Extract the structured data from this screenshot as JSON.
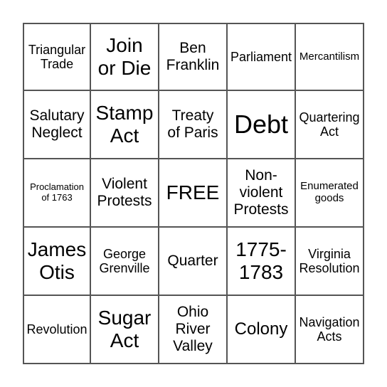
{
  "board": {
    "cells": [
      {
        "text": "Triangular\nTrade",
        "size": "s-md"
      },
      {
        "text": "Join\nor Die",
        "size": "s-xl"
      },
      {
        "text": "Ben\nFranklin",
        "size": "s-ml"
      },
      {
        "text": "Parliament",
        "size": "s-md"
      },
      {
        "text": "Mercantilism",
        "size": "s-sm"
      },
      {
        "text": "Salutary\nNeglect",
        "size": "s-ml"
      },
      {
        "text": "Stamp\nAct",
        "size": "s-xl"
      },
      {
        "text": "Treaty\nof Paris",
        "size": "s-ml"
      },
      {
        "text": "Debt",
        "size": "s-xxl"
      },
      {
        "text": "Quartering\nAct",
        "size": "s-md"
      },
      {
        "text": "Proclamation\nof 1763",
        "size": "s-xs"
      },
      {
        "text": "Violent\nProtests",
        "size": "s-ml"
      },
      {
        "text": "FREE",
        "size": "s-xl"
      },
      {
        "text": "Non-\nviolent\nProtests",
        "size": "s-ml"
      },
      {
        "text": "Enumerated\ngoods",
        "size": "s-sm"
      },
      {
        "text": "James\nOtis",
        "size": "s-xl"
      },
      {
        "text": "George\nGrenville",
        "size": "s-md"
      },
      {
        "text": "Quarter",
        "size": "s-ml"
      },
      {
        "text": "1775-\n1783",
        "size": "s-xl"
      },
      {
        "text": "Virginia\nResolution",
        "size": "s-md"
      },
      {
        "text": "Revolution",
        "size": "s-md"
      },
      {
        "text": "Sugar\nAct",
        "size": "s-xl"
      },
      {
        "text": "Ohio\nRiver\nValley",
        "size": "s-ml"
      },
      {
        "text": "Colony",
        "size": "s-lg"
      },
      {
        "text": "Navigation\nActs",
        "size": "s-md"
      }
    ]
  }
}
